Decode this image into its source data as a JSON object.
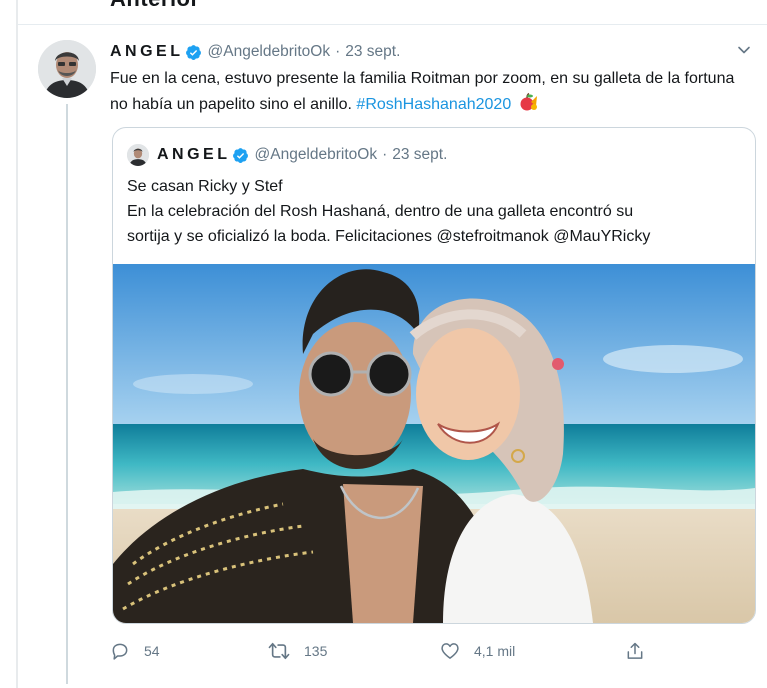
{
  "previous_tweet": {
    "cut_text": "Anterior"
  },
  "tweet": {
    "display_name": "ANGEL",
    "handle": "@AngeldebritoOk",
    "separator": "·",
    "date": "23 sept.",
    "text": "Fue en la cena, estuvo presente la familia Roitman por zoom, en su galleta de la fortuna no había un papelito sino el anillo.",
    "hashtag": "#RoshHashanah2020",
    "emoji_icon": "apple-honey-emoji-icon"
  },
  "quoted_tweet": {
    "display_name": "ANGEL",
    "handle": "@AngeldebritoOk",
    "separator": "·",
    "date": "23 sept.",
    "lines": [
      "Se casan Ricky y Stef",
      "En la celebración del Rosh Hashaná, dentro de una galleta encontró su",
      "sortija y se oficializó la boda. Felicitaciones @stefroitmanok @MauYRicky"
    ],
    "photo": "couple-beach-selfie-photo"
  },
  "actions": {
    "replies": "54",
    "retweets": "135",
    "likes": "4,1 mil"
  },
  "colors": {
    "link": "#1b95e0",
    "muted": "#657786",
    "verified": "#1da1f2",
    "border": "#ccd6dd"
  }
}
